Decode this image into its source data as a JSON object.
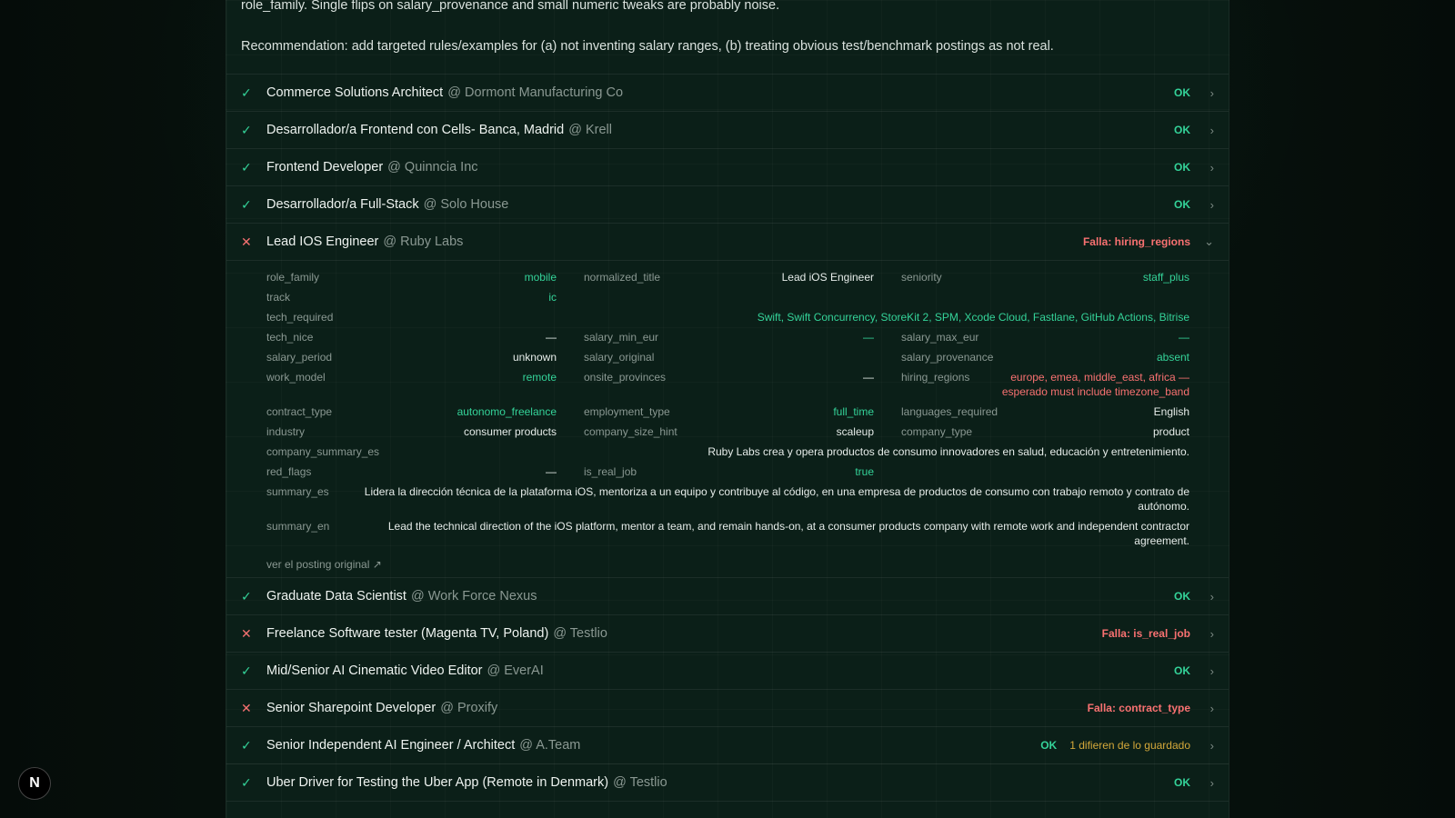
{
  "intro": {
    "line1": "role_family. Single flips on salary_provenance and small numeric tweaks are probably noise.",
    "line2": "Recommendation: add targeted rules/examples for (a) not inventing salary ranges, (b) treating obvious test/benchmark postings as not real."
  },
  "rows_before": [
    {
      "title": "Commerce Solutions Architect",
      "company": "@ Dormont Manufacturing Co",
      "status": "OK"
    },
    {
      "title": "Desarrollador/a Frontend con Cells- Banca, Madrid",
      "company": "@ Krell",
      "status": "OK"
    },
    {
      "title": "Frontend Developer",
      "company": "@ Quinncia Inc",
      "status": "OK"
    },
    {
      "title": "Desarrollador/a Full-Stack",
      "company": "@ Solo House",
      "status": "OK"
    }
  ],
  "expanded": {
    "title": "Lead IOS Engineer",
    "company": "@ Ruby Labs",
    "status": "Falla: hiring_regions",
    "fields": {
      "role_family": {
        "label": "role_family",
        "value": "mobile"
      },
      "normalized_title": {
        "label": "normalized_title",
        "value": "Lead iOS Engineer"
      },
      "seniority": {
        "label": "seniority",
        "value": "staff_plus"
      },
      "track": {
        "label": "track",
        "value": "ic"
      },
      "tech_required": {
        "label": "tech_required",
        "value": "Swift, Swift Concurrency, StoreKit 2, SPM, Xcode Cloud, Fastlane, GitHub Actions, Bitrise"
      },
      "tech_nice": {
        "label": "tech_nice",
        "value": "—"
      },
      "salary_min_eur": {
        "label": "salary_min_eur",
        "value": "—"
      },
      "salary_max_eur": {
        "label": "salary_max_eur",
        "value": "—"
      },
      "salary_period": {
        "label": "salary_period",
        "value": "unknown"
      },
      "salary_original": {
        "label": "salary_original",
        "value": ""
      },
      "salary_provenance": {
        "label": "salary_provenance",
        "value": "absent"
      },
      "work_model": {
        "label": "work_model",
        "value": "remote"
      },
      "onsite_provinces": {
        "label": "onsite_provinces",
        "value": "—"
      },
      "hiring_regions": {
        "label": "hiring_regions",
        "value1": "europe, emea, middle_east, africa —",
        "value2": "esperado must include timezone_band"
      },
      "contract_type": {
        "label": "contract_type",
        "value": "autonomo_freelance"
      },
      "employment_type": {
        "label": "employment_type",
        "value": "full_time"
      },
      "languages_required": {
        "label": "languages_required",
        "value": "English"
      },
      "industry": {
        "label": "industry",
        "value": "consumer products"
      },
      "company_size_hint": {
        "label": "company_size_hint",
        "value": "scaleup"
      },
      "company_type": {
        "label": "company_type",
        "value": "product"
      },
      "company_summary_es": {
        "label": "company_summary_es",
        "value": "Ruby Labs crea y opera productos de consumo innovadores en salud, educación y entretenimiento."
      },
      "red_flags": {
        "label": "red_flags",
        "value": "—"
      },
      "is_real_job": {
        "label": "is_real_job",
        "value": "true"
      },
      "summary_es": {
        "label": "summary_es",
        "value1": "Lidera la dirección técnica de la plataforma iOS, mentoriza a un equipo y contribuye al código, en una empresa de productos de consumo con trabajo remoto y contrato de",
        "value2": "autónomo."
      },
      "summary_en": {
        "label": "summary_en",
        "value1": "Lead the technical direction of the iOS platform, mentor a team, and remain hands-on, at a consumer products company with remote work and independent contractor",
        "value2": "agreement."
      }
    },
    "link": "ver el posting original ↗"
  },
  "rows_after": [
    {
      "title": "Graduate Data Scientist",
      "company": "@ Work Force Nexus",
      "status": "OK",
      "ok": true
    },
    {
      "title": "Freelance Software tester (Magenta TV, Poland)",
      "company": "@ Testlio",
      "status": "Falla: is_real_job",
      "ok": false
    },
    {
      "title": "Mid/Senior AI Cinematic Video Editor",
      "company": "@ EverAI",
      "status": "OK",
      "ok": true
    },
    {
      "title": "Senior Sharepoint Developer",
      "company": "@ Proxify",
      "status": "Falla: contract_type",
      "ok": false
    },
    {
      "title": "Senior Independent AI Engineer / Architect",
      "company": "@ A.Team",
      "status": "OK",
      "ok": true,
      "diff": "1 difieren de lo guardado"
    },
    {
      "title": "Uber Driver for Testing the Uber App (Remote in Denmark)",
      "company": "@ Testlio",
      "status": "OK",
      "ok": true
    }
  ],
  "logo": "N",
  "colors": {
    "ok": "#34d399",
    "fail": "#f87171",
    "diff": "#d4a83a"
  }
}
